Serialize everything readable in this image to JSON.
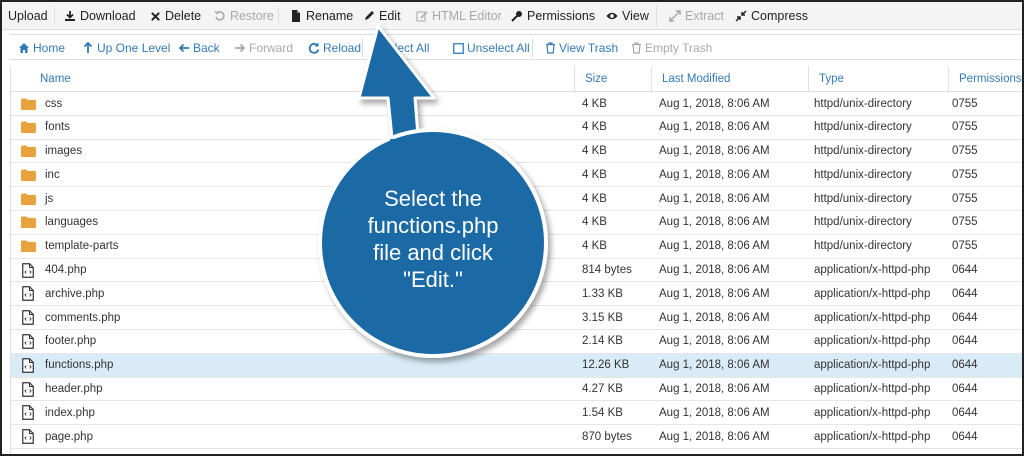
{
  "toolbar_primary": [
    {
      "label": "Upload",
      "icon": "upload-icon",
      "enabled": true
    },
    {
      "label": "Download",
      "icon": "download-icon",
      "enabled": true
    },
    {
      "label": "Delete",
      "icon": "delete-icon",
      "enabled": true
    },
    {
      "label": "Restore",
      "icon": "restore-icon",
      "enabled": false
    },
    {
      "label": "Rename",
      "icon": "rename-icon",
      "enabled": true
    },
    {
      "label": "Edit",
      "icon": "pencil-icon",
      "enabled": true
    },
    {
      "label": "HTML Editor",
      "icon": "html-editor-icon",
      "enabled": false
    },
    {
      "label": "Permissions",
      "icon": "key-icon",
      "enabled": true
    },
    {
      "label": "View",
      "icon": "eye-icon",
      "enabled": true
    },
    {
      "label": "Extract",
      "icon": "extract-icon",
      "enabled": false
    },
    {
      "label": "Compress",
      "icon": "compress-icon",
      "enabled": true
    }
  ],
  "toolbar_secondary": [
    {
      "label": "Home",
      "icon": "home-icon",
      "enabled": true
    },
    {
      "label": "Up One Level",
      "icon": "up-level-icon",
      "enabled": true
    },
    {
      "label": "Back",
      "icon": "back-arrow-icon",
      "enabled": true
    },
    {
      "label": "Forward",
      "icon": "forward-arrow-icon",
      "enabled": false
    },
    {
      "label": "Reload",
      "icon": "reload-icon",
      "enabled": true
    },
    {
      "label": "elect All",
      "icon": "select-all-icon",
      "enabled": true
    },
    {
      "label": "Unselect All",
      "icon": "checkbox-icon",
      "enabled": true
    },
    {
      "label": "View Trash",
      "icon": "trash-icon",
      "enabled": true
    },
    {
      "label": "Empty Trash",
      "icon": "trash-icon",
      "enabled": false
    }
  ],
  "table": {
    "columns": {
      "name": "Name",
      "size": "Size",
      "modified": "Last Modified",
      "type": "Type",
      "permissions": "Permissions"
    },
    "rows": [
      {
        "name": "css",
        "size": "4 KB",
        "modified": "Aug 1, 2018, 8:06 AM",
        "type": "httpd/unix-directory",
        "permissions": "0755",
        "kind": "folder",
        "selected": false
      },
      {
        "name": "fonts",
        "size": "4 KB",
        "modified": "Aug 1, 2018, 8:06 AM",
        "type": "httpd/unix-directory",
        "permissions": "0755",
        "kind": "folder",
        "selected": false
      },
      {
        "name": "images",
        "size": "4 KB",
        "modified": "Aug 1, 2018, 8:06 AM",
        "type": "httpd/unix-directory",
        "permissions": "0755",
        "kind": "folder",
        "selected": false
      },
      {
        "name": "inc",
        "size": "4 KB",
        "modified": "Aug 1, 2018, 8:06 AM",
        "type": "httpd/unix-directory",
        "permissions": "0755",
        "kind": "folder",
        "selected": false
      },
      {
        "name": "js",
        "size": "4 KB",
        "modified": "Aug 1, 2018, 8:06 AM",
        "type": "httpd/unix-directory",
        "permissions": "0755",
        "kind": "folder",
        "selected": false
      },
      {
        "name": "languages",
        "size": "4 KB",
        "modified": "Aug 1, 2018, 8:06 AM",
        "type": "httpd/unix-directory",
        "permissions": "0755",
        "kind": "folder",
        "selected": false
      },
      {
        "name": "template-parts",
        "size": "4 KB",
        "modified": "Aug 1, 2018, 8:06 AM",
        "type": "httpd/unix-directory",
        "permissions": "0755",
        "kind": "folder",
        "selected": false
      },
      {
        "name": "404.php",
        "size": "814 bytes",
        "modified": "Aug 1, 2018, 8:06 AM",
        "type": "application/x-httpd-php",
        "permissions": "0644",
        "kind": "file",
        "selected": false
      },
      {
        "name": "archive.php",
        "size": "1.33 KB",
        "modified": "Aug 1, 2018, 8:06 AM",
        "type": "application/x-httpd-php",
        "permissions": "0644",
        "kind": "file",
        "selected": false
      },
      {
        "name": "comments.php",
        "size": "3.15 KB",
        "modified": "Aug 1, 2018, 8:06 AM",
        "type": "application/x-httpd-php",
        "permissions": "0644",
        "kind": "file",
        "selected": false
      },
      {
        "name": "footer.php",
        "size": "2.14 KB",
        "modified": "Aug 1, 2018, 8:06 AM",
        "type": "application/x-httpd-php",
        "permissions": "0644",
        "kind": "file",
        "selected": false
      },
      {
        "name": "functions.php",
        "size": "12.26 KB",
        "modified": "Aug 1, 2018, 8:06 AM",
        "type": "application/x-httpd-php",
        "permissions": "0644",
        "kind": "file",
        "selected": true
      },
      {
        "name": "header.php",
        "size": "4.27 KB",
        "modified": "Aug 1, 2018, 8:06 AM",
        "type": "application/x-httpd-php",
        "permissions": "0644",
        "kind": "file",
        "selected": false
      },
      {
        "name": "index.php",
        "size": "1.54 KB",
        "modified": "Aug 1, 2018, 8:06 AM",
        "type": "application/x-httpd-php",
        "permissions": "0644",
        "kind": "file",
        "selected": false
      },
      {
        "name": "page.php",
        "size": "870 bytes",
        "modified": "Aug 1, 2018, 8:06 AM",
        "type": "application/x-httpd-php",
        "permissions": "0644",
        "kind": "file",
        "selected": false
      }
    ]
  },
  "callout": {
    "lines": [
      "Select the",
      "functions.php",
      "file and click",
      "\"Edit.\""
    ],
    "color": "#1b6aa5"
  },
  "colors": {
    "link": "#337ab7",
    "folder": "#e8a33d",
    "selected_row": "#d9ebf7",
    "disabled": "#a8a8a8"
  }
}
